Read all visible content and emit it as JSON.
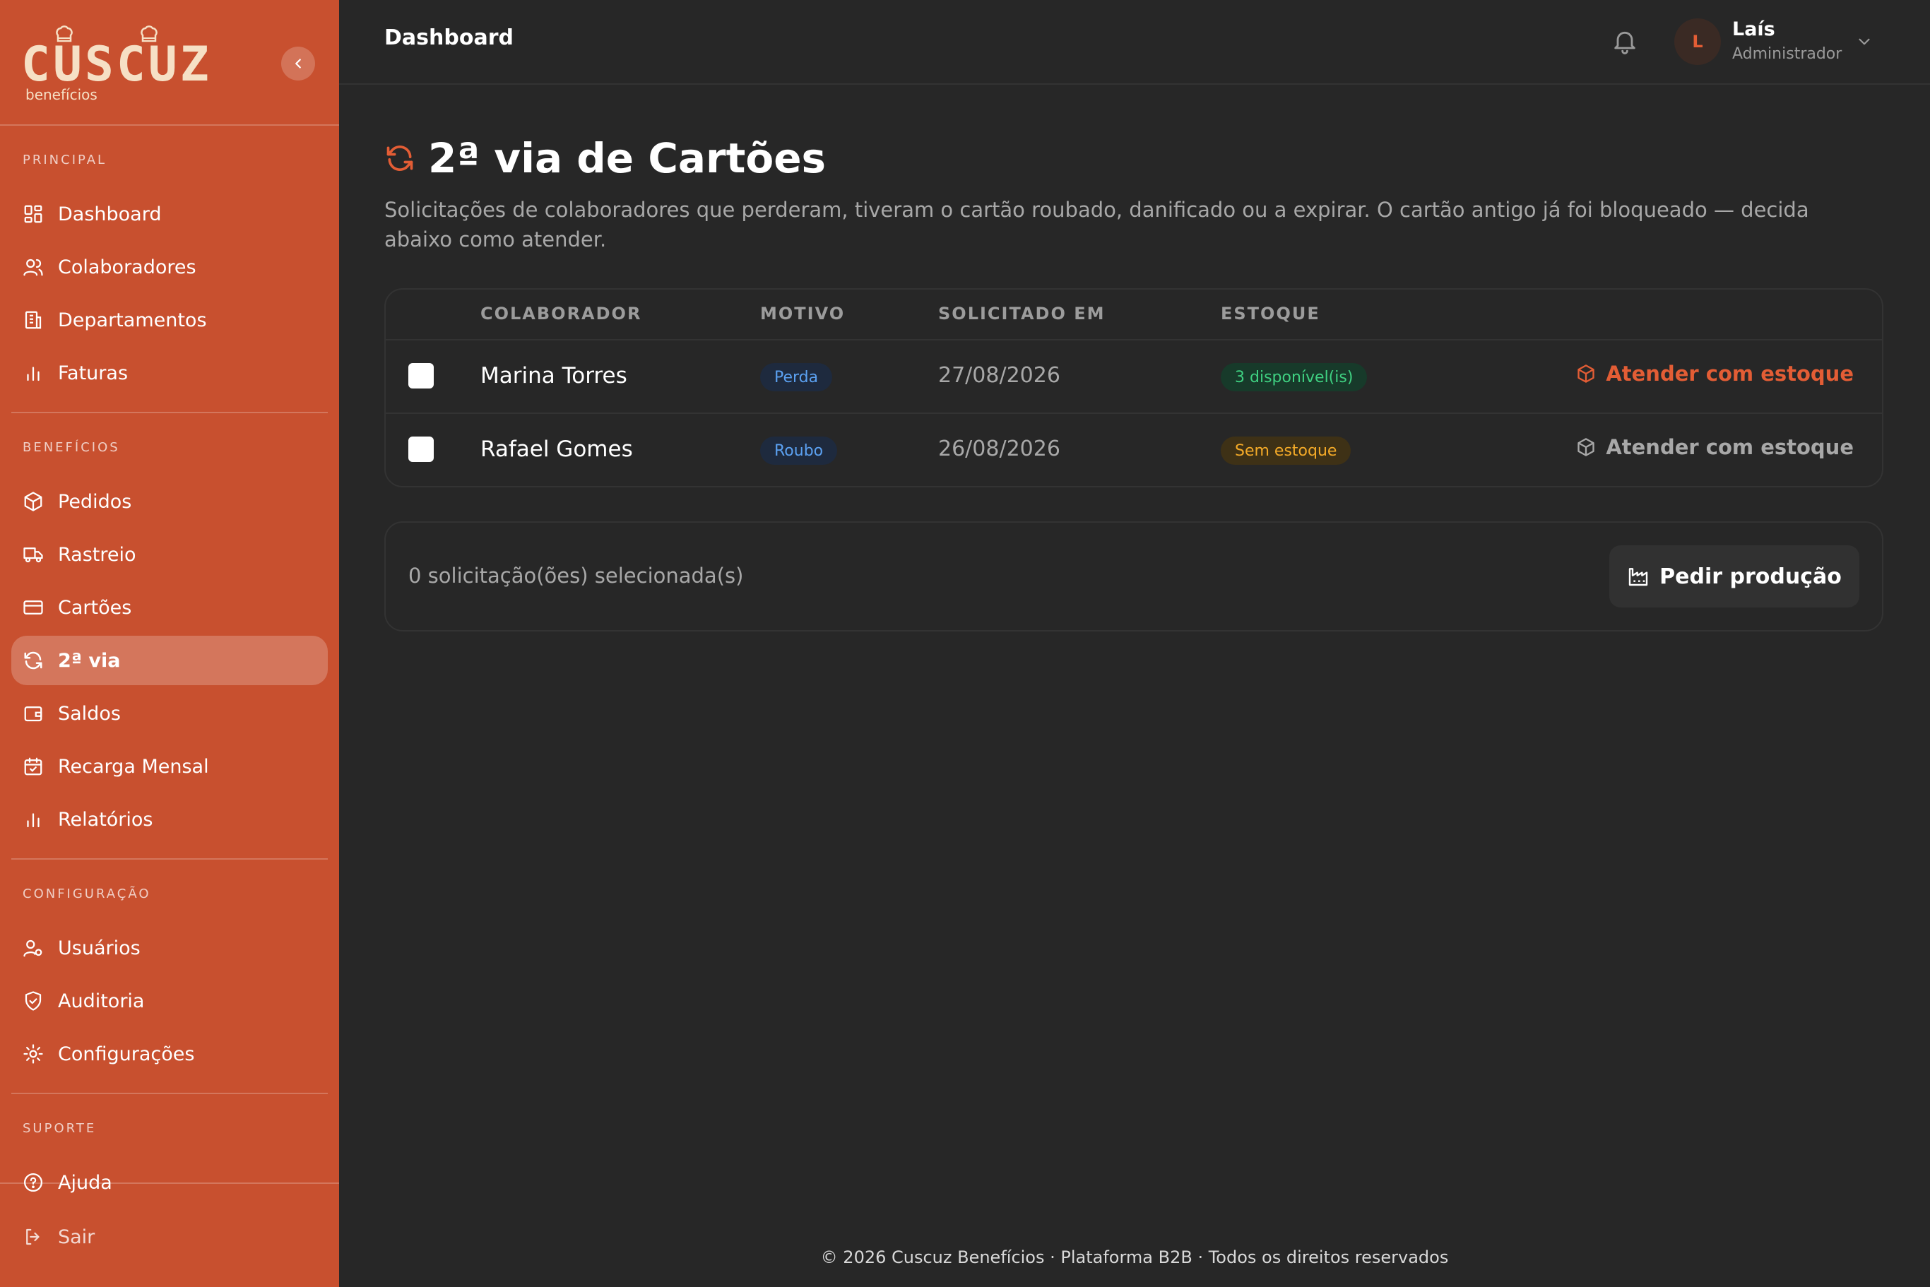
{
  "brand": {
    "logo_text": "CUSCUZ",
    "logo_subtitle": "benefícios"
  },
  "header": {
    "title": "Dashboard"
  },
  "user": {
    "initial": "L",
    "name": "Laís",
    "role": "Administrador"
  },
  "sidebar": {
    "sections": [
      {
        "label": "PRINCIPAL",
        "items": [
          {
            "label": "Dashboard",
            "icon": "dashboard-icon"
          },
          {
            "label": "Colaboradores",
            "icon": "users-icon"
          },
          {
            "label": "Departamentos",
            "icon": "building-icon"
          },
          {
            "label": "Faturas",
            "icon": "bar-chart-icon"
          }
        ]
      },
      {
        "label": "BENEFÍCIOS",
        "items": [
          {
            "label": "Pedidos",
            "icon": "package-icon"
          },
          {
            "label": "Rastreio",
            "icon": "truck-icon"
          },
          {
            "label": "Cartões",
            "icon": "credit-card-icon"
          },
          {
            "label": "2ª via",
            "icon": "refresh-icon",
            "active": true
          },
          {
            "label": "Saldos",
            "icon": "wallet-icon"
          },
          {
            "label": "Recarga Mensal",
            "icon": "calendar-icon"
          },
          {
            "label": "Relatórios",
            "icon": "bar-chart-icon"
          }
        ]
      },
      {
        "label": "CONFIGURAÇÃO",
        "items": [
          {
            "label": "Usuários",
            "icon": "user-cog-icon"
          },
          {
            "label": "Auditoria",
            "icon": "shield-check-icon"
          },
          {
            "label": "Configurações",
            "icon": "gear-icon"
          }
        ]
      },
      {
        "label": "SUPORTE",
        "items": [
          {
            "label": "Ajuda",
            "icon": "help-icon"
          }
        ]
      }
    ],
    "logout_label": "Sair"
  },
  "page": {
    "title": "2ª via de Cartões",
    "description": "Solicitações de colaboradores que perderam, tiveram o cartão roubado, danificado ou a expirar. O cartão antigo já foi bloqueado — decida abaixo como atender."
  },
  "table": {
    "columns": [
      "COLABORADOR",
      "MOTIVO",
      "SOLICITADO EM",
      "ESTOQUE"
    ],
    "rows": [
      {
        "colaborador": "Marina Torres",
        "motivo": "Perda",
        "solicitado_em": "27/08/2026",
        "estoque": "3 disponível(is)",
        "estoque_status": "available",
        "action": "Atender com estoque",
        "action_enabled": true
      },
      {
        "colaborador": "Rafael Gomes",
        "motivo": "Roubo",
        "solicitado_em": "26/08/2026",
        "estoque": "Sem estoque",
        "estoque_status": "out",
        "action": "Atender com estoque",
        "action_enabled": false
      }
    ]
  },
  "selection": {
    "count_text": "0 solicitação(ões) selecionada(s)",
    "button_label": "Pedir produção"
  },
  "footer": {
    "copyright": "© 2026 Cuscuz Benefícios · Plataforma B2B · Todos os direitos reservados"
  },
  "colors": {
    "sidebar_bg": "#c8502f",
    "page_bg": "#272727",
    "accent": "#e35d35",
    "badge_blue": "#5ba0f0",
    "badge_green": "#3fd081",
    "badge_amber": "#f4aa28"
  }
}
